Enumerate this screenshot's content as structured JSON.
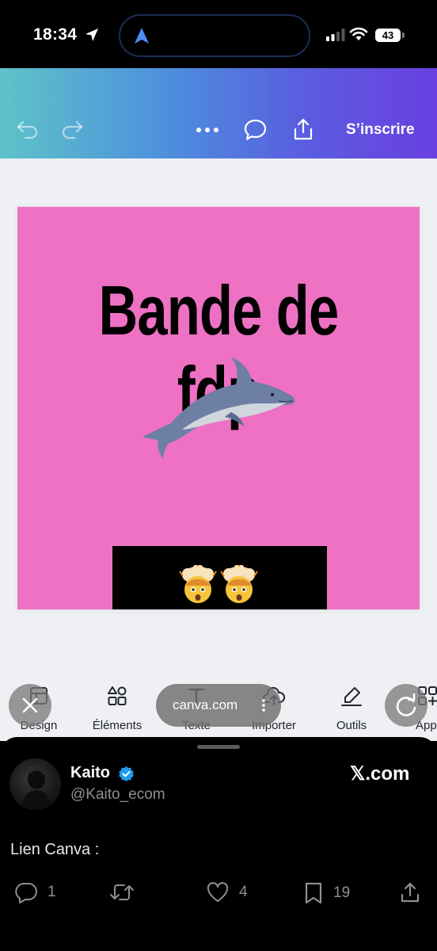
{
  "status_bar": {
    "time": "18:34",
    "battery": "43",
    "icons": [
      "location-arrow-icon",
      "navigation-icon",
      "signal-icon",
      "wifi-icon",
      "battery-icon"
    ]
  },
  "toolbar": {
    "signup_label": "S’inscrire",
    "icons": [
      "undo-icon",
      "redo-icon",
      "more-icon",
      "comment-icon",
      "share-icon"
    ],
    "gradient": [
      "#5ec3c9",
      "#6a3fe0"
    ]
  },
  "design": {
    "headline": "Bande de fdp",
    "background_color": "#ee71c4",
    "images": [
      "dolphin",
      "exploding-head-emoji",
      "exploding-head-emoji"
    ]
  },
  "tools": [
    {
      "label": "Design",
      "icon": "design-icon"
    },
    {
      "label": "Éléments",
      "icon": "elements-icon"
    },
    {
      "label": "Texte",
      "icon": "text-icon"
    },
    {
      "label": "Importer",
      "icon": "upload-cloud-icon"
    },
    {
      "label": "Outils",
      "icon": "pen-tool-icon"
    },
    {
      "label": "Appl",
      "icon": "apps-icon"
    }
  ],
  "browser": {
    "url": "canva.com"
  },
  "tweet": {
    "name": "Kaito",
    "handle": "@Kaito_ecom",
    "source": "𝕏.com",
    "text": "Lien Canva :",
    "replies": "1",
    "likes": "4",
    "bookmarks": "19"
  }
}
